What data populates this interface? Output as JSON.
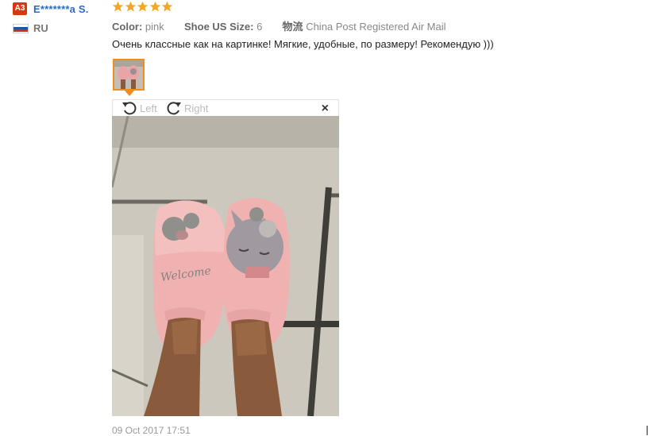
{
  "review": {
    "level_badge": "A3",
    "username": "E*******a S.",
    "country": "RU",
    "rating": 5,
    "attributes": {
      "color_label": "Color:",
      "color_value": "pink",
      "size_label": "Shoe US Size:",
      "size_value": "6",
      "shipping_label": "物流",
      "shipping_value": "China Post Registered Air Mail"
    },
    "comment": "Очень классные как на картинке! Мягкие, удобные, по размеру! Рекомендую )))",
    "viewer": {
      "rotate_left_label": "Left",
      "rotate_right_label": "Right",
      "close_symbol": "×"
    },
    "date": "09 Oct 2017 17:51"
  },
  "colors": {
    "accent": "#f28c1a",
    "username": "#2b6cc4",
    "badge": "#d8380d",
    "star": "#f5a623"
  }
}
